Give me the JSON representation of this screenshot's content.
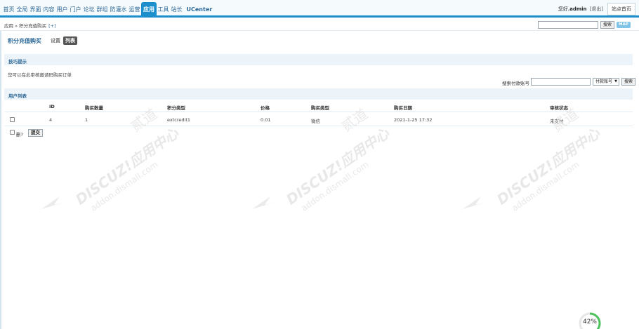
{
  "topnav": {
    "items": [
      "首页",
      "全局",
      "界面",
      "内容",
      "用户",
      "门户",
      "论坛",
      "群组",
      "防灌水",
      "运营",
      "应用",
      "工具",
      "站长"
    ],
    "active_index": 10,
    "brand": "UCenter",
    "greeting": "您好, ",
    "username": "admin",
    "logout": "[退出]",
    "home": "站点首页"
  },
  "crumb": {
    "text": "应用 » 积分充值购买",
    "plus": "[+]"
  },
  "topsearch": {
    "button": "搜索",
    "map": "MAP"
  },
  "page": {
    "title": "积分充值购买",
    "tabs": [
      "设置",
      "列表"
    ],
    "active_tab": 1
  },
  "tips": {
    "heading": "技巧提示",
    "text": "您可以在此审核邀请码购买订单"
  },
  "search": {
    "label": "搜索付款账号",
    "select_value": "付款账号",
    "button": "搜索"
  },
  "list": {
    "heading": "用户列表",
    "columns": [
      "ID",
      "购买数量",
      "积分类型",
      "价格",
      "购买类型",
      "购买日期",
      "审核状态"
    ],
    "rows": [
      [
        "4",
        "1",
        "extcredit1",
        "0.01",
        "微信",
        "2021-1-25 17:32",
        "未支付"
      ]
    ]
  },
  "footer": {
    "delete_label": "删?",
    "submit": "提交"
  },
  "watermark": {
    "brand": "DISCUZ!应用中心",
    "domain": "addon.dismall.com",
    "seal": "贰道"
  },
  "progress": {
    "percent": 42,
    "label": "42%"
  },
  "colors": {
    "accent": "#1a8fcb",
    "link": "#2b6797",
    "section_bg": "#ecf4fa"
  }
}
